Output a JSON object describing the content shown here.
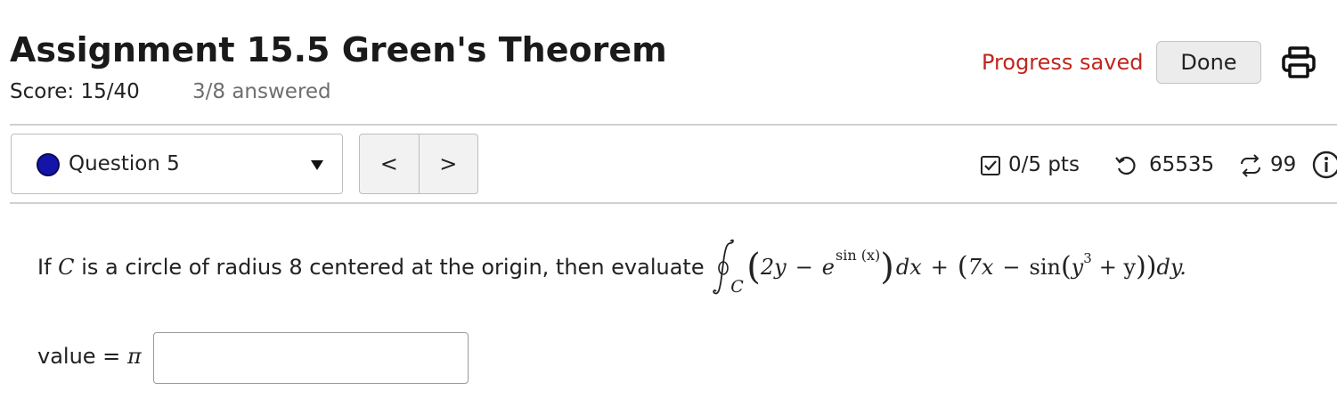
{
  "header": {
    "title": "Assignment 15.5 Green's Theorem",
    "score": "Score: 15/40",
    "answered": "3/8 answered",
    "progress_status": "Progress saved",
    "done_label": "Done",
    "colors": {
      "progress_status": "#c0261d"
    }
  },
  "question_nav": {
    "selected": "Question 5",
    "status_color": "#1414a8",
    "prev_label": "<",
    "next_label": ">"
  },
  "stats": {
    "points": "0/5 pts",
    "retries": "65535",
    "attempts": "99"
  },
  "question": {
    "prefix_if": "If",
    "var_c": "C",
    "text": "is a circle of radius 8 centered at the origin, then evaluate",
    "integral_subscript": "C",
    "math": {
      "coef_2y": "2y",
      "minus": "−",
      "e": "e",
      "exponent": "sin (x)",
      "dx": "dx",
      "plus": "+",
      "coef_7x": "7x",
      "sin": "sin",
      "y": "y",
      "cube": "3",
      "plus_y": "+ y",
      "dy": "dy."
    }
  },
  "answer": {
    "label": "value =",
    "pi": "π",
    "value": "",
    "placeholder": ""
  },
  "icons": [
    "print-icon",
    "checkbox-icon",
    "retry-icon",
    "attempts-icon",
    "info-icon"
  ]
}
